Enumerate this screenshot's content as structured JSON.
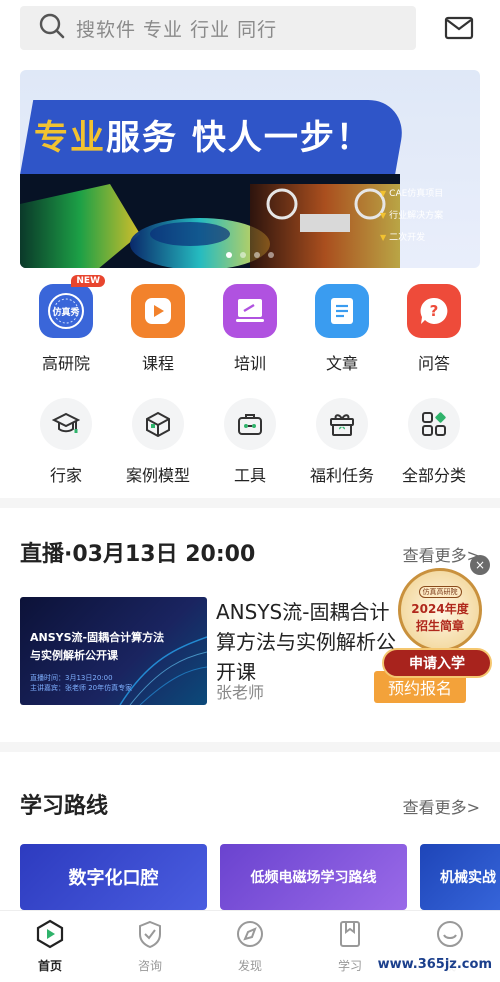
{
  "search": {
    "placeholder": "搜软件 专业 行业 同行"
  },
  "icons": {
    "search": "search-icon",
    "mail": "mail-icon"
  },
  "banner": {
    "headline_highlight": "专业",
    "headline_rest": "服务 快人一步！",
    "points": [
      "CAE仿真项目",
      "行业解决方案",
      "二次开发"
    ],
    "slide_count": 4,
    "active_slide": 0
  },
  "primary_nav": [
    {
      "label": "高研院",
      "icon": "academy-seal-icon",
      "color": "#3a66d9",
      "badge": "NEW",
      "icon_text": "仿真秀"
    },
    {
      "label": "课程",
      "icon": "play-icon",
      "color": "#f2822c"
    },
    {
      "label": "培训",
      "icon": "training-screen-icon",
      "color": "#b052e0"
    },
    {
      "label": "文章",
      "icon": "article-icon",
      "color": "#3a9cf0"
    },
    {
      "label": "问答",
      "icon": "question-icon",
      "color": "#ee4b3a"
    }
  ],
  "secondary_nav": [
    {
      "label": "行家",
      "icon": "graduation-cap-icon"
    },
    {
      "label": "案例模型",
      "icon": "cube-icon"
    },
    {
      "label": "工具",
      "icon": "toolbox-icon"
    },
    {
      "label": "福利任务",
      "icon": "gift-icon"
    },
    {
      "label": "全部分类",
      "icon": "grid-icon"
    }
  ],
  "live": {
    "title": "直播·03月13日 20:00",
    "more": "查看更多>",
    "course_title": "ANSYS流-固耦合计算方法与实例解析公开课",
    "thumb_title": "ANSYS流-固耦合计算方法\n与实例解析公开课",
    "thumb_meta_1": "直播时间：3月13日20:00",
    "thumb_meta_2": "主讲嘉宾：张老师 20年仿真专家",
    "teacher": "张老师",
    "reserve": "预约报名"
  },
  "promo": {
    "tag": "仿真高研院",
    "line1": "2024年度",
    "line2": "招生简章",
    "button": "申请入学",
    "close": "×"
  },
  "route": {
    "title": "学习路线",
    "more": "查看更多>",
    "cards": [
      {
        "label": "数字化口腔",
        "color": "#3a46c8"
      },
      {
        "label": "低频电磁场学习路线",
        "color": "#7b4fd6"
      },
      {
        "label": "机械实战",
        "color": "#2c56c9"
      }
    ]
  },
  "tabbar": [
    {
      "label": "首页",
      "icon": "home-play-icon",
      "active": true
    },
    {
      "label": "咨询",
      "icon": "shield-icon",
      "active": false
    },
    {
      "label": "发现",
      "icon": "compass-icon",
      "active": false
    },
    {
      "label": "学习",
      "icon": "bookmark-icon",
      "active": false
    },
    {
      "label": "我",
      "icon": "profile-icon",
      "active": false
    }
  ],
  "watermark": "www.365jz.com"
}
